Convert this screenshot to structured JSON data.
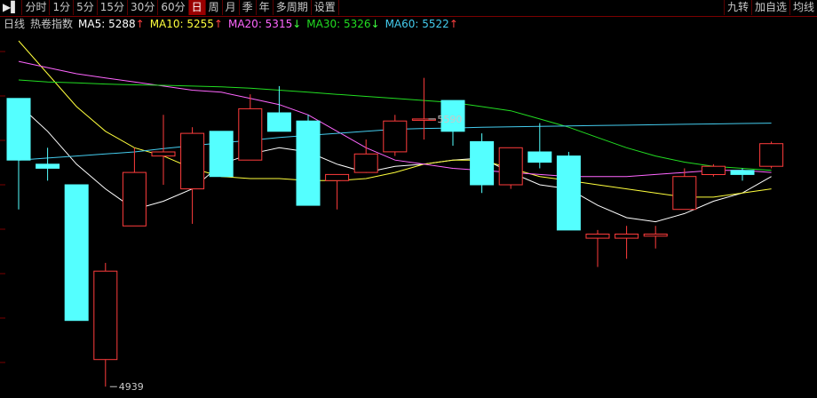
{
  "toolbar": {
    "items": [
      {
        "label": "▶▌",
        "active": false
      },
      {
        "label": "分时",
        "active": false
      },
      {
        "label": "1分",
        "active": false
      },
      {
        "label": "5分",
        "active": false
      },
      {
        "label": "15分",
        "active": false
      },
      {
        "label": "30分",
        "active": false
      },
      {
        "label": "60分",
        "active": false
      },
      {
        "label": "日",
        "active": true
      },
      {
        "label": "周",
        "active": false
      },
      {
        "label": "月",
        "active": false
      },
      {
        "label": "季",
        "active": false
      },
      {
        "label": "年",
        "active": false
      },
      {
        "label": "多周期",
        "active": false
      },
      {
        "label": "设置",
        "active": false
      }
    ],
    "right_items": [
      {
        "label": "九转"
      },
      {
        "label": "加自选"
      },
      {
        "label": "均线"
      }
    ]
  },
  "legend": {
    "period": "日线",
    "name": "热卷指数",
    "ma": [
      {
        "label": "MA5: 5288",
        "arrow": "↑",
        "color": "#ffffff",
        "arrow_color": "#ff4040"
      },
      {
        "label": "MA10: 5255",
        "arrow": "↑",
        "color": "#ffff3c",
        "arrow_color": "#ff4040"
      },
      {
        "label": "MA20: 5315",
        "arrow": "↓",
        "color": "#ff66ff",
        "arrow_color": "#40ff40"
      },
      {
        "label": "MA30: 5326",
        "arrow": "↓",
        "color": "#22dd22",
        "arrow_color": "#40ff40"
      },
      {
        "label": "MA60: 5522",
        "arrow": "↑",
        "color": "#44ccee",
        "arrow_color": "#ff4040"
      }
    ]
  },
  "chart_data": {
    "type": "candlestick",
    "ylim": [
      4920,
      5780
    ],
    "grid": true,
    "up_color": "#ff3c3c",
    "down_color": "#54ffff",
    "candles": [
      {
        "o": 5640,
        "h": 5640,
        "l": 5370,
        "c": 5490
      },
      {
        "o": 5480,
        "h": 5520,
        "l": 5440,
        "c": 5470
      },
      {
        "o": 5430,
        "h": 5430,
        "l": 5100,
        "c": 5100
      },
      {
        "o": 5005,
        "h": 5240,
        "l": 4939,
        "c": 5220
      },
      {
        "o": 5330,
        "h": 5520,
        "l": 5330,
        "c": 5460
      },
      {
        "o": 5500,
        "h": 5600,
        "l": 5430,
        "c": 5510
      },
      {
        "o": 5420,
        "h": 5570,
        "l": 5335,
        "c": 5555
      },
      {
        "o": 5560,
        "h": 5560,
        "l": 5470,
        "c": 5450
      },
      {
        "o": 5490,
        "h": 5650,
        "l": 5490,
        "c": 5615
      },
      {
        "o": 5605,
        "h": 5670,
        "l": 5560,
        "c": 5560
      },
      {
        "o": 5585,
        "h": 5600,
        "l": 5380,
        "c": 5380
      },
      {
        "o": 5440,
        "h": 5450,
        "l": 5370,
        "c": 5455
      },
      {
        "o": 5460,
        "h": 5540,
        "l": 5460,
        "c": 5505
      },
      {
        "o": 5510,
        "h": 5600,
        "l": 5500,
        "c": 5585
      },
      {
        "o": 5590,
        "h": 5690,
        "l": 5540,
        "c": 5590
      },
      {
        "o": 5635,
        "h": 5605,
        "l": 5525,
        "c": 5560
      },
      {
        "o": 5535,
        "h": 5555,
        "l": 5410,
        "c": 5430
      },
      {
        "o": 5430,
        "h": 5510,
        "l": 5420,
        "c": 5520
      },
      {
        "o": 5510,
        "h": 5580,
        "l": 5470,
        "c": 5485
      },
      {
        "o": 5500,
        "h": 5510,
        "l": 5320,
        "c": 5320
      },
      {
        "o": 5300,
        "h": 5320,
        "l": 5230,
        "c": 5310
      },
      {
        "o": 5300,
        "h": 5330,
        "l": 5250,
        "c": 5310
      },
      {
        "o": 5305,
        "h": 5330,
        "l": 5275,
        "c": 5310
      },
      {
        "o": 5370,
        "h": 5470,
        "l": 5370,
        "c": 5450
      },
      {
        "o": 5455,
        "h": 5480,
        "l": 5450,
        "c": 5475
      },
      {
        "o": 5465,
        "h": 5470,
        "l": 5440,
        "c": 5455
      },
      {
        "o": 5475,
        "h": 5535,
        "l": 5470,
        "c": 5530
      }
    ],
    "ma_lines": [
      {
        "name": "MA5",
        "color": "#ffffff",
        "values": [
          5625,
          5560,
          5480,
          5420,
          5370,
          5390,
          5420,
          5480,
          5505,
          5520,
          5510,
          5480,
          5460,
          5475,
          5480,
          5490,
          5495,
          5460,
          5430,
          5420,
          5380,
          5350,
          5340,
          5360,
          5390,
          5410,
          5450
        ]
      },
      {
        "name": "MA10",
        "color": "#ffff3c",
        "values": [
          5780,
          5700,
          5620,
          5560,
          5520,
          5500,
          5470,
          5450,
          5445,
          5445,
          5440,
          5440,
          5445,
          5460,
          5480,
          5490,
          5490,
          5470,
          5450,
          5440,
          5430,
          5420,
          5410,
          5400,
          5400,
          5410,
          5420
        ]
      },
      {
        "name": "MA20",
        "color": "#ff66ff",
        "values": [
          5730,
          5715,
          5700,
          5690,
          5680,
          5670,
          5660,
          5655,
          5640,
          5625,
          5600,
          5560,
          5520,
          5490,
          5480,
          5470,
          5465,
          5460,
          5455,
          5450,
          5450,
          5450,
          5455,
          5460,
          5465,
          5465,
          5460
        ]
      },
      {
        "name": "MA30",
        "color": "#22dd22",
        "values": [
          5685,
          5680,
          5678,
          5675,
          5673,
          5672,
          5670,
          5668,
          5665,
          5660,
          5655,
          5650,
          5645,
          5640,
          5635,
          5630,
          5620,
          5610,
          5590,
          5570,
          5545,
          5520,
          5500,
          5485,
          5475,
          5470,
          5465
        ]
      },
      {
        "name": "MA60",
        "color": "#44ccee",
        "values": [
          5490,
          5495,
          5500,
          5505,
          5510,
          5518,
          5525,
          5532,
          5538,
          5545,
          5550,
          5555,
          5560,
          5565,
          5567,
          5568,
          5570,
          5571,
          5572,
          5573,
          5574,
          5575,
          5576,
          5577,
          5578,
          5579,
          5580
        ]
      }
    ],
    "annotations": [
      {
        "candle": 14,
        "price": 5590,
        "text": "5590"
      },
      {
        "candle": 3,
        "price": 4939,
        "text": "4939"
      }
    ]
  }
}
